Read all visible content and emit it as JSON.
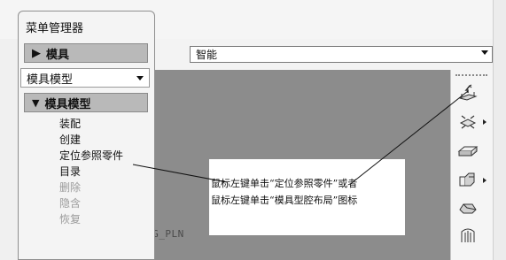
{
  "menu_manager": {
    "title": "菜单管理器",
    "mold_header": "模具",
    "mode_select": "模具模型",
    "section_header": "模具模型",
    "items": [
      {
        "label": "装配",
        "enabled": true
      },
      {
        "label": "创建",
        "enabled": true
      },
      {
        "label": "定位参照零件",
        "enabled": true
      },
      {
        "label": "目录",
        "enabled": true
      },
      {
        "label": "删除",
        "enabled": false
      },
      {
        "label": "隐含",
        "enabled": false
      },
      {
        "label": "恢复",
        "enabled": false
      }
    ]
  },
  "filter": {
    "value": "智能"
  },
  "viewport": {
    "partial_label": "NG_PLN"
  },
  "annotation": {
    "line1": "鼠标左键单击“定位参照零件”或者",
    "line2": "鼠标左键单击“模具型腔布局”图标"
  },
  "toolbar": {
    "icons": [
      "mold-layout-icon",
      "cavity-layout-icon",
      "workpiece-icon",
      "component-icon",
      "shrinkage-icon",
      "split-surface-icon"
    ]
  },
  "colors": {
    "viewport_bg": "#8c8c8c",
    "header_bg": "#b9b9b9",
    "disabled_text": "#9b9b9b"
  }
}
